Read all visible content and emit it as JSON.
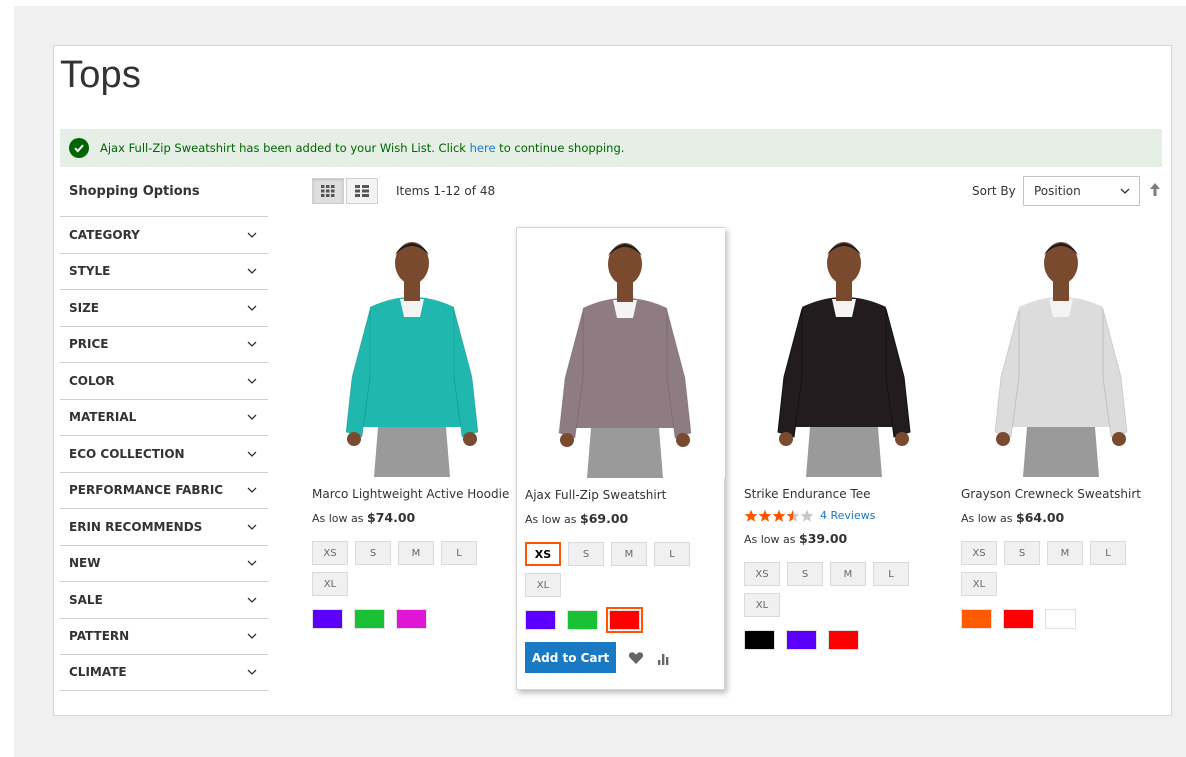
{
  "page": {
    "title": "Tops"
  },
  "message": {
    "text_before": "Ajax Full-Zip Sweatshirt has been added to your Wish List. Click ",
    "link": "here",
    "text_after": " to continue shopping."
  },
  "sidebar": {
    "title": "Shopping Options",
    "filters": [
      "CATEGORY",
      "STYLE",
      "SIZE",
      "PRICE",
      "COLOR",
      "MATERIAL",
      "ECO COLLECTION",
      "PERFORMANCE FABRIC",
      "ERIN RECOMMENDS",
      "NEW",
      "SALE",
      "PATTERN",
      "CLIMATE"
    ]
  },
  "toolbar": {
    "amount": "Items 1-12 of 48",
    "sort_label": "Sort By",
    "sort_value": "Position",
    "view_modes": [
      "grid-icon",
      "list-icon"
    ]
  },
  "products": [
    {
      "name": "Marco Lightweight Active Hoodie",
      "price_prefix": "As low as ",
      "price": "$74.00",
      "sizes": [
        "XS",
        "S",
        "M",
        "L",
        "XL"
      ],
      "colors": [
        "#5b00ff",
        "#1bc134",
        "#e016d6"
      ],
      "shirt_color": "#1fb7ae"
    },
    {
      "name": "Ajax Full-Zip Sweatshirt",
      "price_prefix": "As low as ",
      "price": "$69.00",
      "sizes": [
        "XS",
        "S",
        "M",
        "L",
        "XL"
      ],
      "selected_size": "XS",
      "colors": [
        "#5b00ff",
        "#1bc134",
        "#ff0000"
      ],
      "selected_color": "#ff0000",
      "add_to_cart": "Add to Cart",
      "shirt_color": "#8f7c82"
    },
    {
      "name": "Strike Endurance Tee",
      "rating_stars": 3.5,
      "reviews": "4  Reviews",
      "price_prefix": "As low as ",
      "price": "$39.00",
      "sizes": [
        "XS",
        "S",
        "M",
        "L",
        "XL"
      ],
      "colors": [
        "#000000",
        "#5b00ff",
        "#ff0000"
      ],
      "shirt_color": "#221c1e"
    },
    {
      "name": "Grayson Crewneck Sweatshirt",
      "price_prefix": "As low as ",
      "price": "$64.00",
      "sizes": [
        "XS",
        "S",
        "M",
        "L",
        "XL"
      ],
      "colors": [
        "#ff5a00",
        "#ff0000",
        "#ffffff"
      ],
      "shirt_color": "#dcdcdc"
    }
  ]
}
